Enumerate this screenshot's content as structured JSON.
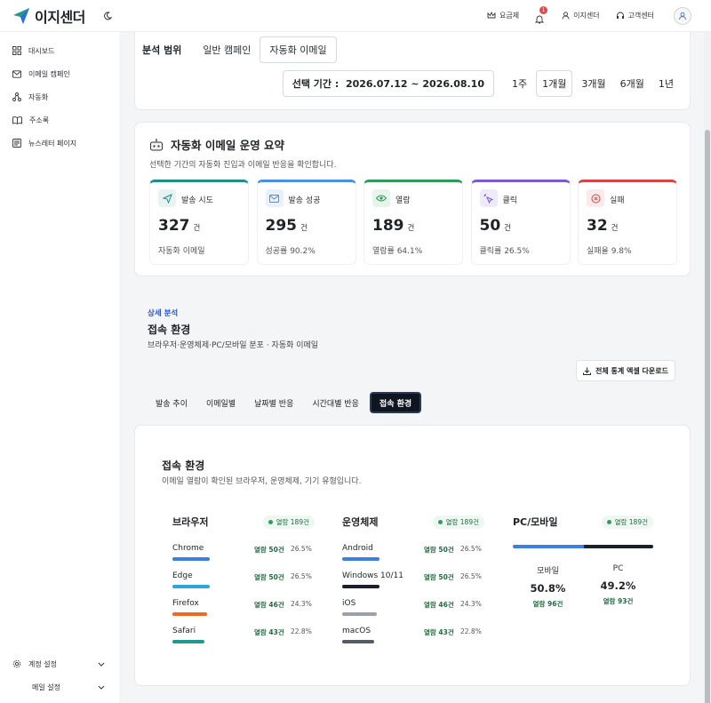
{
  "header": {
    "brand": "이지센더",
    "pricing": "요금제",
    "notification_count": "1",
    "account": "이지센더",
    "support": "고객센터"
  },
  "sidebar": {
    "items": [
      {
        "label": "대시보드",
        "icon": "dashboard-icon"
      },
      {
        "label": "이메일 캠페인",
        "icon": "mail-icon"
      },
      {
        "label": "자동화",
        "icon": "automation-icon"
      },
      {
        "label": "주소록",
        "icon": "book-icon"
      },
      {
        "label": "뉴스레터 페이지",
        "icon": "newsletter-icon"
      }
    ],
    "bottom": [
      {
        "label": "계정 설정",
        "icon": "gear-icon"
      },
      {
        "label": "메일 설정",
        "icon": "mail-settings-icon"
      }
    ]
  },
  "scope": {
    "label": "분석 범위",
    "tabs": [
      "일반 캠페인",
      "자동화 이메일"
    ],
    "active_tab": "자동화 이메일",
    "period_label": "선택 기간",
    "period_value": "2026.07.12 ~ 2026.08.10",
    "periods": [
      "1주",
      "1개월",
      "3개월",
      "6개월",
      "1년"
    ],
    "active_period": "1개월"
  },
  "summary": {
    "title": "자동화 이메일 운영 요약",
    "subtitle": "선택한 기간의 자동화 진입과 이메일 반응을 확인합니다.",
    "unit": "건",
    "stats": [
      {
        "label": "발송 시도",
        "value": "327",
        "sub": "자동화 이메일",
        "color": "#1d8f8a",
        "icon": "send-icon"
      },
      {
        "label": "발송 성공",
        "value": "295",
        "sub": "성공률 90.2%",
        "color": "#4a8fe0",
        "icon": "mail-icon"
      },
      {
        "label": "열람",
        "value": "189",
        "sub": "열람률 64.1%",
        "color": "#2e9b5c",
        "icon": "eye-icon"
      },
      {
        "label": "클릭",
        "value": "50",
        "sub": "클릭률 26.5%",
        "color": "#7a5ad1",
        "icon": "click-icon"
      },
      {
        "label": "실패",
        "value": "32",
        "sub": "실패율 9.8%",
        "color": "#d64545",
        "icon": "fail-icon"
      }
    ]
  },
  "detail": {
    "kicker": "상세 분석",
    "title": "접속 환경",
    "subtitle": "브라우저·운영체제·PC/모바일 분포 · 자동화 이메일",
    "excel": "전체 통계 엑셀 다운로드",
    "tabs": [
      "발송 추이",
      "이메일별",
      "날짜별 반응",
      "시간대별 반응",
      "접속 환경"
    ],
    "active_tab": "접속 환경"
  },
  "env": {
    "title": "접속 환경",
    "subtitle": "이메일 열람이 확인된 브라우저, 운영체제, 기기 유형입니다.",
    "browser": {
      "title": "브라우저",
      "badge": "열람 189건",
      "rows": [
        {
          "name": "Chrome",
          "open": "열람 50건",
          "pct": "26.5%",
          "color": "#3d7fe0"
        },
        {
          "name": "Edge",
          "open": "열람 50건",
          "pct": "26.5%",
          "color": "#2aa6dc"
        },
        {
          "name": "Firefox",
          "open": "열람 46건",
          "pct": "24.3%",
          "color": "#ee6a1f"
        },
        {
          "name": "Safari",
          "open": "열람 43건",
          "pct": "22.8%",
          "color": "#1e9a8f"
        }
      ]
    },
    "os": {
      "title": "운영체제",
      "badge": "열람 189건",
      "rows": [
        {
          "name": "Android",
          "open": "열람 50건",
          "pct": "26.5%",
          "color": "#3d7fe0"
        },
        {
          "name": "Windows 10/11",
          "open": "열람 50건",
          "pct": "26.5%",
          "color": "#1a1f2a"
        },
        {
          "name": "iOS",
          "open": "열람 46건",
          "pct": "24.3%",
          "color": "#9aa1aa"
        },
        {
          "name": "macOS",
          "open": "열람 43건",
          "pct": "22.8%",
          "color": "#555c66"
        }
      ]
    },
    "device": {
      "title": "PC/모바일",
      "badge": "열람 189건",
      "mobile": {
        "name": "모바일",
        "pct": "50.8%",
        "open": "열람 96건",
        "share": 50.8,
        "color": "#3d7fe0"
      },
      "pc": {
        "name": "PC",
        "pct": "49.2%",
        "open": "열람 93건",
        "share": 49.2,
        "color": "#1a1f2a"
      }
    }
  }
}
